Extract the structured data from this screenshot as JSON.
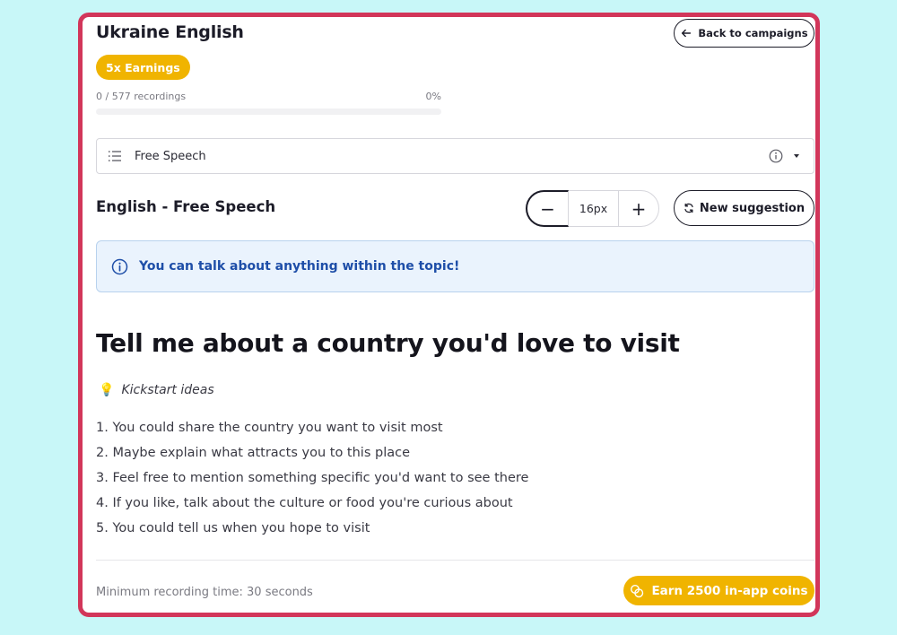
{
  "campaign": {
    "title": "Ukraine English",
    "back_label": "Back to campaigns",
    "badge": "5x Earnings",
    "progress_text": "0 / 577 recordings",
    "progress_percent_text": "0%",
    "progress_fraction": 0.0
  },
  "topic_select": {
    "selected": "Free Speech"
  },
  "section": {
    "title": "English - Free Speech",
    "font_size_value": "16px",
    "new_suggestion_label": "New suggestion"
  },
  "notice": {
    "text": "You can talk about anything within the topic!"
  },
  "prompt": {
    "title": "Tell me about a country you'd love to visit",
    "kickstart_label": "Kickstart ideas",
    "ideas": [
      "1. You could share the country you want to visit most",
      "2. Maybe explain what attracts you to this place",
      "3. Feel free to mention something specific you'd want to see there",
      "4. If you like, talk about the culture or food you're curious about",
      "5. You could tell us when you hope to visit"
    ]
  },
  "footer": {
    "min_time": "Minimum recording time: 30 seconds",
    "earn_label": "Earn 2500 in-app coins"
  },
  "colors": {
    "background": "#c8f7f8",
    "border_accent": "#d2365a",
    "brand_yellow": "#f0b400",
    "notice_blue": "#1e4ea8"
  },
  "icons": {
    "back": "arrow-left-icon",
    "select": "list-icon",
    "info": "info-icon",
    "refresh": "refresh-icon",
    "bulb": "lightbulb-icon",
    "coins": "coins-icon"
  }
}
